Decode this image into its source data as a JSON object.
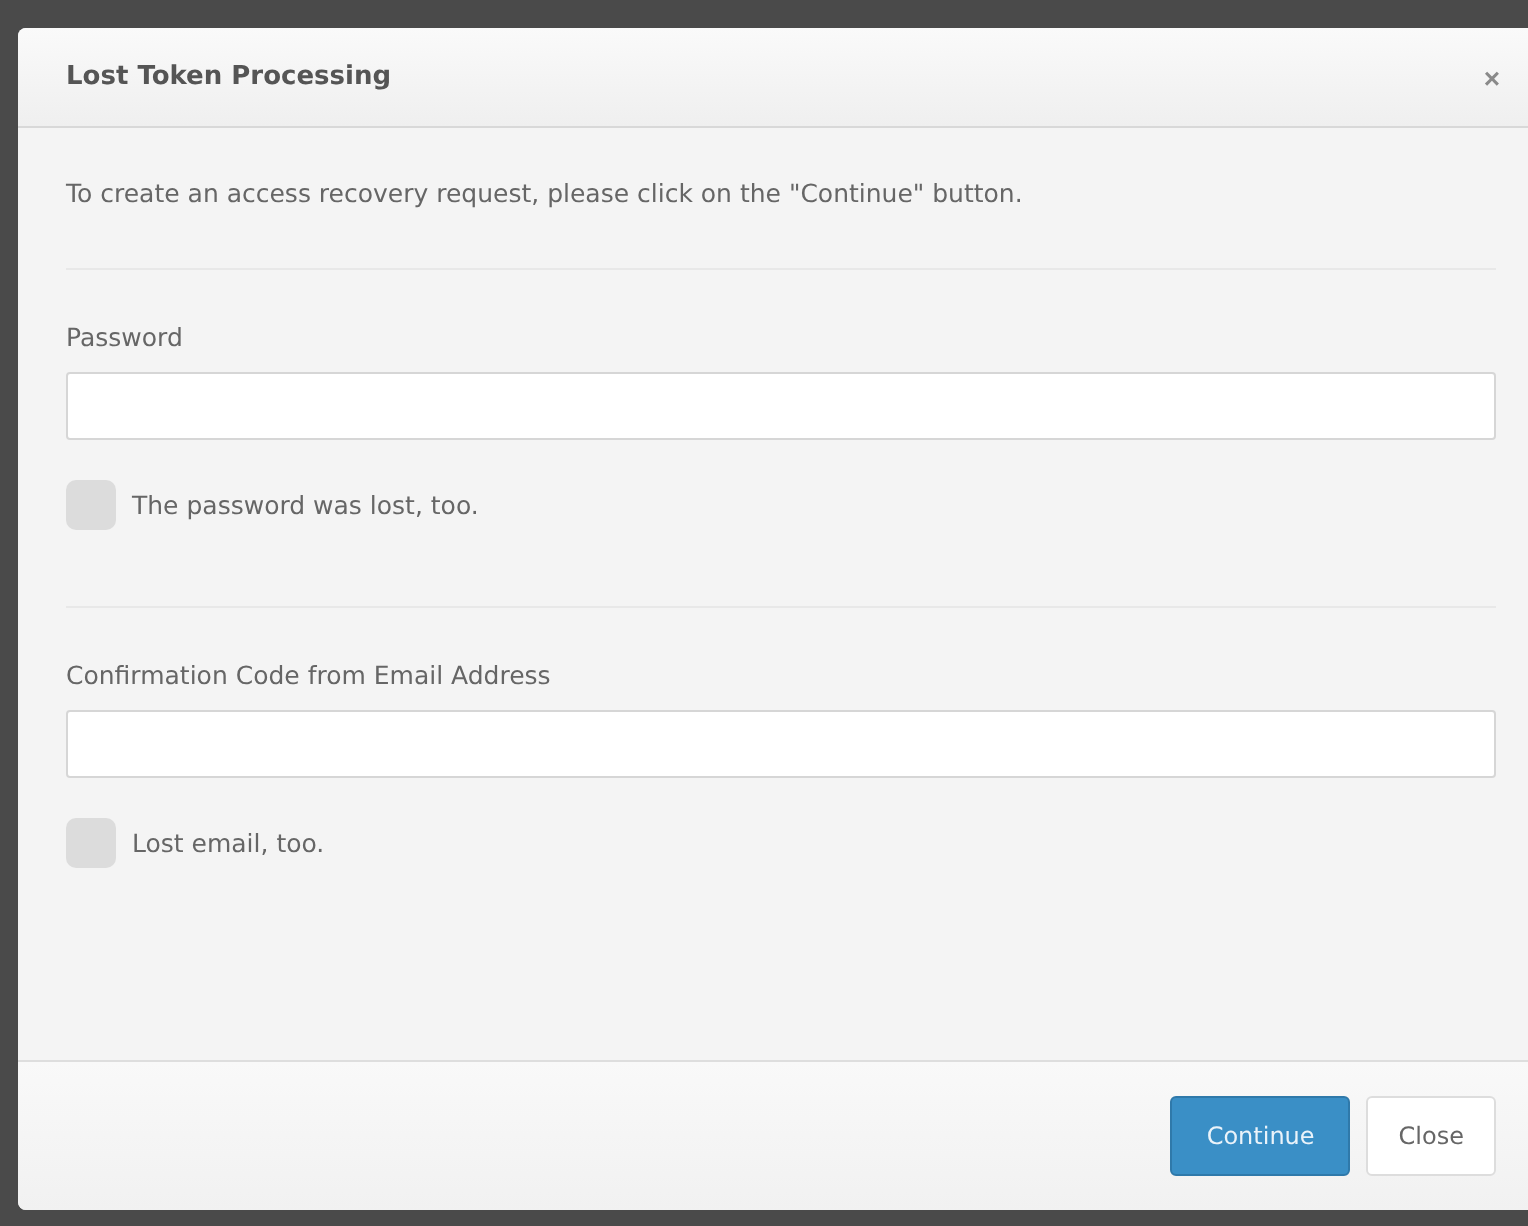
{
  "dialog": {
    "title": "Lost Token Processing",
    "close_glyph": "×"
  },
  "intro": "To create an access recovery request, please click on the \"Continue\" button.",
  "sections": [
    {
      "field": {
        "label": "Password"
      },
      "checkbox": {
        "label": "The password was lost, too.",
        "checked": false
      }
    },
    {
      "field": {
        "label": "Confirmation Code from Email Address"
      },
      "checkbox": {
        "label": "Lost email, too.",
        "checked": false
      }
    }
  ],
  "buttons": [
    {
      "label": "Continue",
      "kind": "primary"
    },
    {
      "label": "Close",
      "kind": "default"
    }
  ]
}
